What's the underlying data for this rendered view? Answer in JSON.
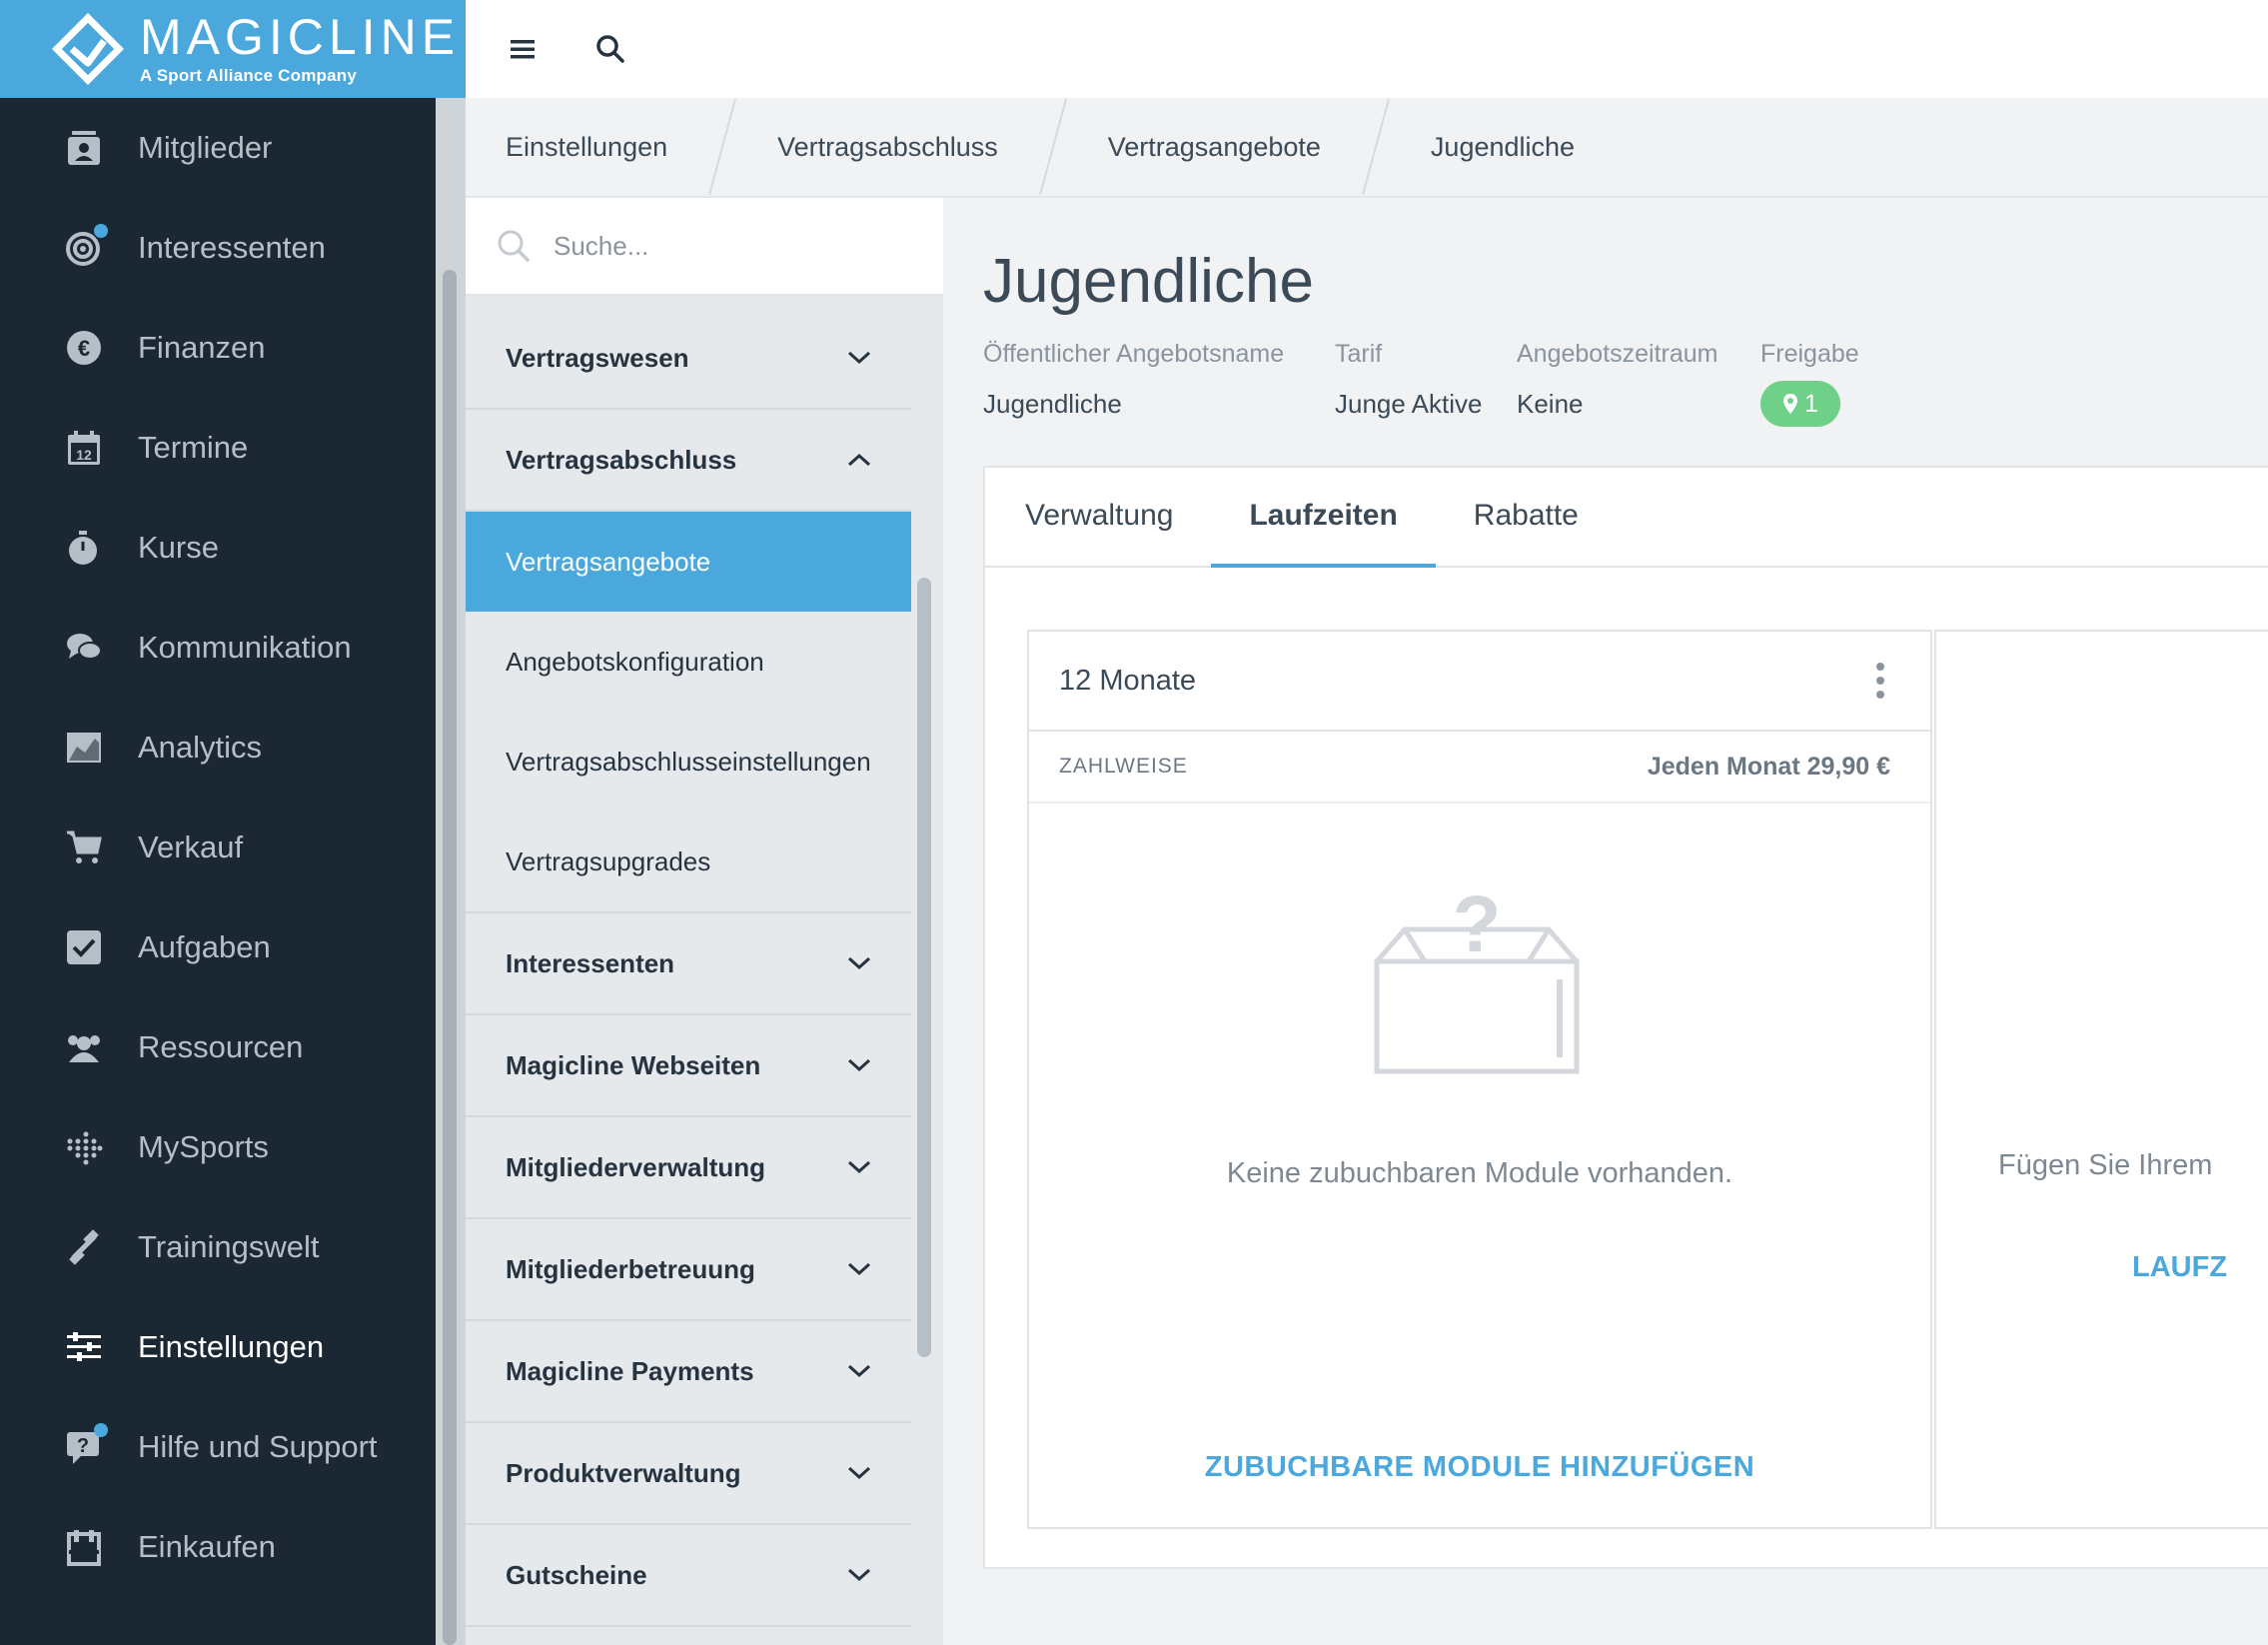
{
  "brand": {
    "name": "MAGICLINE",
    "tagline": "A Sport Alliance Company"
  },
  "nav": {
    "items": [
      {
        "label": "Mitglieder",
        "icon": "members-card-icon"
      },
      {
        "label": "Interessenten",
        "icon": "target-icon"
      },
      {
        "label": "Finanzen",
        "icon": "euro-icon"
      },
      {
        "label": "Termine",
        "icon": "calendar-icon"
      },
      {
        "label": "Kurse",
        "icon": "stopwatch-icon"
      },
      {
        "label": "Kommunikation",
        "icon": "chat-bubbles-icon"
      },
      {
        "label": "Analytics",
        "icon": "area-chart-icon"
      },
      {
        "label": "Verkauf",
        "icon": "cart-icon"
      },
      {
        "label": "Aufgaben",
        "icon": "checkbox-icon"
      },
      {
        "label": "Ressourcen",
        "icon": "people-group-icon"
      },
      {
        "label": "MySports",
        "icon": "mysports-dots-icon"
      },
      {
        "label": "Trainingswelt",
        "icon": "dumbbell-icon"
      },
      {
        "label": "Einstellungen",
        "icon": "sliders-icon",
        "active": true
      },
      {
        "label": "Hilfe und Support",
        "icon": "help-chat-icon"
      },
      {
        "label": "Einkaufen",
        "icon": "shop-icon"
      }
    ],
    "calendar_day": "12"
  },
  "breadcrumb": [
    "Einstellungen",
    "Vertragsabschluss",
    "Vertragsangebote",
    "Jugendliche"
  ],
  "submenu": {
    "search_placeholder": "Suche...",
    "items": {
      "vertragswesen": "Vertragswesen",
      "vertragsabschluss": "Vertragsabschluss",
      "sub": [
        "Vertragsangebote",
        "Angebotskonfiguration",
        "Vertragsabschlusseinstellungen",
        "Vertragsupgrades"
      ],
      "interessenten": "Interessenten",
      "webseiten": "Magicline Webseiten",
      "mitgliederverwaltung": "Mitgliederverwaltung",
      "mitgliederbetreuung": "Mitgliederbetreuung",
      "payments": "Magicline Payments",
      "produktverwaltung": "Produktverwaltung",
      "gutscheine": "Gutscheine"
    }
  },
  "main": {
    "title": "Jugendliche",
    "meta": {
      "public_name_label": "Öffentlicher Angebotsname",
      "public_name_value": "Jugendliche",
      "tariff_label": "Tarif",
      "tariff_value": "Junge Aktive",
      "period_label": "Angebotszeitraum",
      "period_value": "Keine",
      "release_label": "Freigabe",
      "release_count": "1"
    },
    "tabs": [
      "Verwaltung",
      "Laufzeiten",
      "Rabatte"
    ],
    "active_tab": "Laufzeiten",
    "card": {
      "title": "12 Monate",
      "payment_label": "ZAHLWEISE",
      "payment_value": "Jeden Monat 29,90 €",
      "empty_text": "Keine zubuchbaren Module vorhanden.",
      "action": "ZUBUCHBARE MODULE HINZUFÜGEN"
    },
    "card2": {
      "partial_text": "Fügen Sie Ihrem",
      "partial_link": "LAUFZ"
    }
  },
  "colors": {
    "brand": "#4aa8dc",
    "nav_bg": "#1b2733",
    "badge": "#6fd08a"
  }
}
